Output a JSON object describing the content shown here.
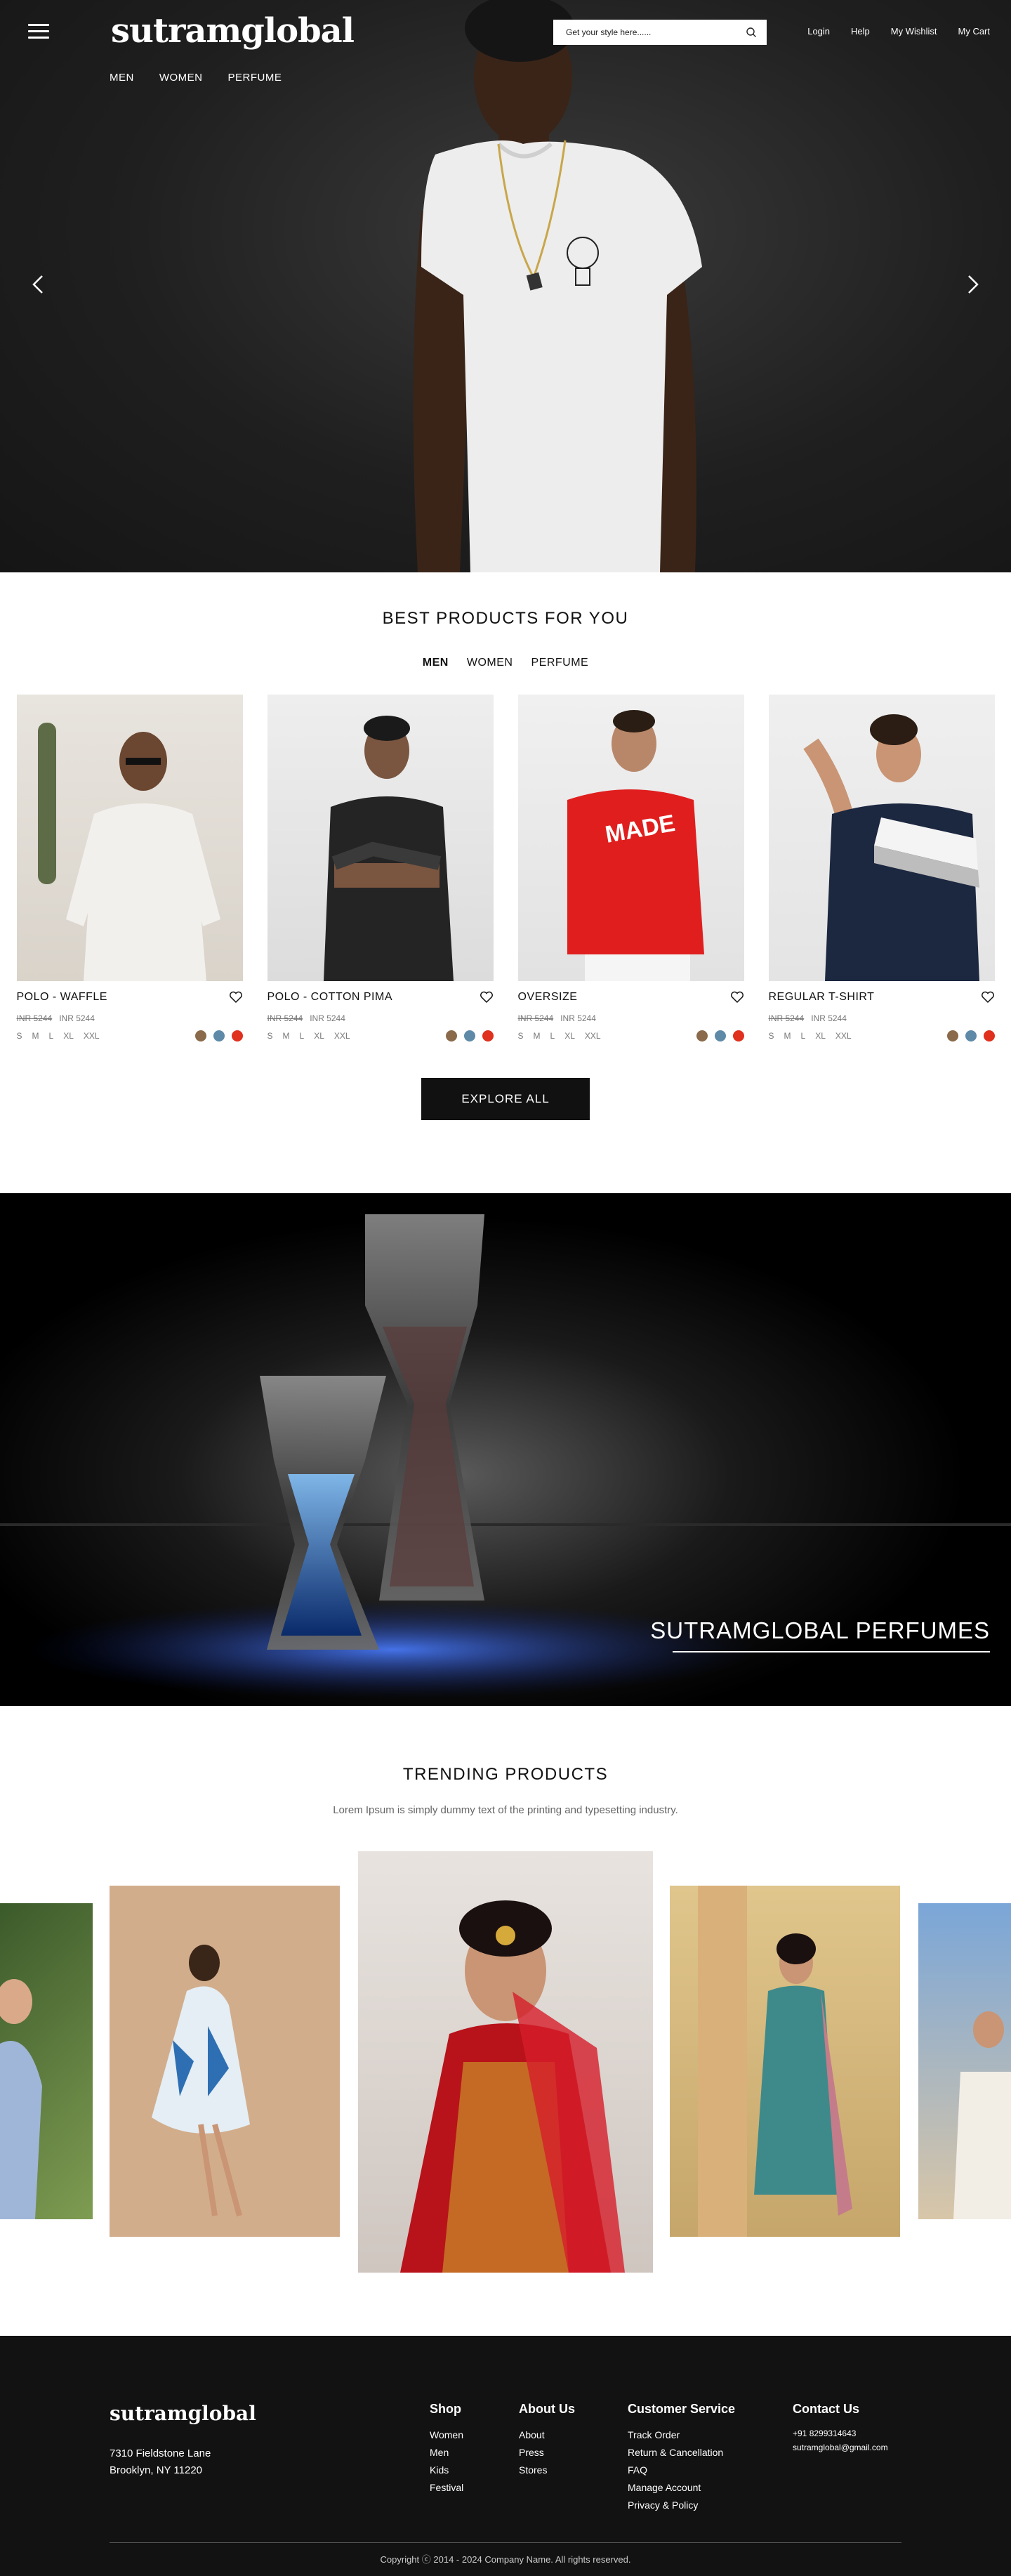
{
  "brand": "sutramglobal",
  "header": {
    "nav": [
      "MEN",
      "WOMEN",
      "PERFUME"
    ],
    "search_placeholder": "Get your style here......",
    "utility": [
      "Login",
      "Help",
      "My Wishlist",
      "My Cart"
    ]
  },
  "best": {
    "title": "BEST PRODUCTS FOR YOU",
    "tabs": [
      "MEN",
      "WOMEN",
      "PERFUME"
    ],
    "active_tab": "MEN",
    "products": [
      {
        "name": "POLO - WAFFLE",
        "old_price": "INR 5244",
        "price": "INR 5244",
        "sizes": [
          "S",
          "M",
          "L",
          "XL",
          "XXL"
        ],
        "colors": [
          "#8a6a4a",
          "#5e8aa8",
          "#e0301e"
        ]
      },
      {
        "name": "POLO - COTTON PIMA",
        "old_price": "INR 5244",
        "price": "INR 5244",
        "sizes": [
          "S",
          "M",
          "L",
          "XL",
          "XXL"
        ],
        "colors": [
          "#8a6a4a",
          "#5e8aa8",
          "#e0301e"
        ]
      },
      {
        "name": "OVERSIZE",
        "old_price": "INR 5244",
        "price": "INR 5244",
        "sizes": [
          "S",
          "M",
          "L",
          "XL",
          "XXL"
        ],
        "colors": [
          "#8a6a4a",
          "#5e8aa8",
          "#e0301e"
        ]
      },
      {
        "name": "REGULAR T-SHIRT",
        "old_price": "INR 5244",
        "price": "INR 5244",
        "sizes": [
          "S",
          "M",
          "L",
          "XL",
          "XXL"
        ],
        "colors": [
          "#8a6a4a",
          "#5e8aa8",
          "#e0301e"
        ]
      }
    ],
    "explore_label": "EXPLORE ALL"
  },
  "perfume": {
    "title": "SUTRAMGLOBAL PERFUMES"
  },
  "trending": {
    "title": "TRENDING PRODUCTS",
    "subtitle": "Lorem Ipsum is simply dummy text of the printing and typesetting industry."
  },
  "footer": {
    "brand": "sutramglobal",
    "address_line1": "7310 Fieldstone Lane",
    "address_line2": "Brooklyn, NY 11220",
    "shop": {
      "title": "Shop",
      "links": [
        "Women",
        "Men",
        "Kids",
        "Festival"
      ]
    },
    "about": {
      "title": "About Us",
      "links": [
        "About",
        "Press",
        "Stores"
      ]
    },
    "service": {
      "title": "Customer Service",
      "links": [
        "Track Order",
        "Return & Cancellation",
        "FAQ",
        "Manage Account",
        "Privacy & Policy"
      ]
    },
    "contact": {
      "title": "Contact Us",
      "phone": "+91 8299314643",
      "email": "sutramglobal@gmail.com"
    },
    "copyright": "Copyright ⓒ 2014 - 2024  Company Name. All rights reserved."
  }
}
